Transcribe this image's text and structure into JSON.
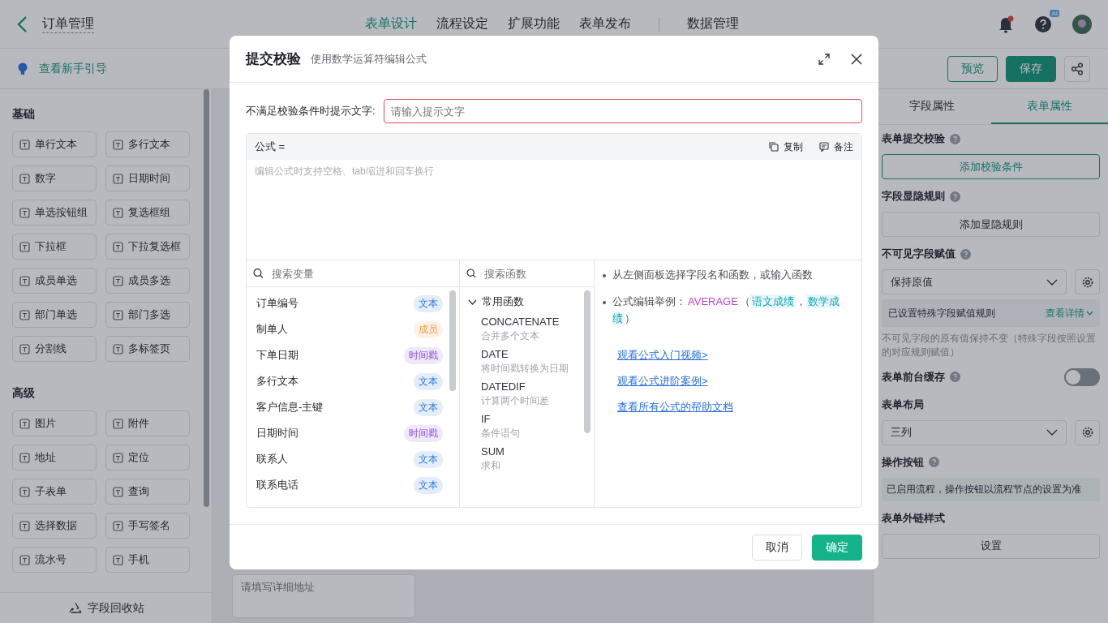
{
  "header": {
    "title": "订单管理",
    "nav": [
      {
        "label": "表单设计",
        "selected": true
      },
      {
        "label": "流程设定",
        "selected": false
      },
      {
        "label": "扩展功能",
        "selected": false
      },
      {
        "label": "表单发布",
        "selected": false
      }
    ],
    "data_nav": {
      "label": "数据管理",
      "selected": false
    },
    "notification": {
      "unread": true
    },
    "help_badge": "AI"
  },
  "toolbar": {
    "guide_link": "查看新手引导",
    "buttons": [
      {
        "label": "预览",
        "kind": "outline"
      },
      {
        "label": "保存",
        "kind": "primary"
      }
    ]
  },
  "sidebar": {
    "sections": [
      {
        "title": "基础",
        "items": [
          "单行文本",
          "多行文本",
          "数字",
          "日期时间",
          "单选按钮组",
          "复选框组",
          "下拉框",
          "下拉复选框",
          "成员单选",
          "成员多选",
          "部门单选",
          "部门多选",
          "分割线",
          "多标签页"
        ]
      },
      {
        "title": "高级",
        "items": [
          "图片",
          "附件",
          "地址",
          "定位",
          "子表单",
          "查询",
          "选择数据",
          "手写签名",
          "流水号",
          "手机"
        ]
      }
    ],
    "footer": "字段回收站"
  },
  "canvas": {
    "address_placeholder": "请填写详细地址"
  },
  "properties": {
    "tabs": [
      {
        "label": "字段属性",
        "selected": false
      },
      {
        "label": "表单属性",
        "selected": true
      }
    ],
    "sections": [
      {
        "title": "表单提交校验",
        "help": true,
        "controls": [
          {
            "kind": "button",
            "label": "添加校验条件",
            "accent": true
          }
        ]
      },
      {
        "title": "字段显隐规则",
        "help": true,
        "controls": [
          {
            "kind": "button",
            "label": "添加显隐规则",
            "accent": false
          }
        ]
      },
      {
        "title": "不可见字段赋值",
        "help": true,
        "controls": [
          {
            "kind": "select",
            "value": "保持原值"
          },
          {
            "kind": "notice",
            "text": "已设置特殊字段赋值规则",
            "link": "查看详情"
          },
          {
            "kind": "note",
            "text": "不可见字段的原有值保持不变（特殊字段按照设置的对应规则赋值）"
          }
        ]
      },
      {
        "title": "表单前台缓存",
        "help": true,
        "switch": {
          "on": false
        }
      },
      {
        "title": "表单布局",
        "help": false,
        "controls": [
          {
            "kind": "select",
            "value": "三列"
          }
        ]
      },
      {
        "title": "操作按钮",
        "help": true,
        "controls": [
          {
            "kind": "info",
            "text": "已启用流程，操作按钮以流程节点的设置为准"
          }
        ]
      },
      {
        "title": "表单外链样式",
        "help": false,
        "controls": [
          {
            "kind": "button",
            "label": "设置",
            "accent": false
          }
        ]
      }
    ]
  },
  "modal": {
    "title": "提交校验",
    "subtitle": "使用数学运算符编辑公式",
    "message": {
      "label": "不满足校验条件时提示文字:",
      "placeholder": "请输入提示文字",
      "invalid": true
    },
    "formula": {
      "label": "公式 =",
      "actions": [
        {
          "label": "复制",
          "kind": "copy"
        },
        {
          "label": "备注",
          "kind": "note"
        }
      ],
      "placeholder": "编辑公式时支持空格、tab缩进和回车换行"
    },
    "variables": {
      "search_placeholder": "搜索变量",
      "items": [
        {
          "name": "订单编号",
          "type": "文本",
          "color": "#2f7be0"
        },
        {
          "name": "制单人",
          "type": "成员",
          "color": "#f59a4a"
        },
        {
          "name": "下单日期",
          "type": "时间戳",
          "color": "#8a4fd8"
        },
        {
          "name": "多行文本",
          "type": "文本",
          "color": "#2f7be0"
        },
        {
          "name": "客户信息-主键",
          "type": "文本",
          "color": "#2f7be0"
        },
        {
          "name": "日期时间",
          "type": "时间戳",
          "color": "#8a4fd8"
        },
        {
          "name": "联系人",
          "type": "文本",
          "color": "#2f7be0"
        },
        {
          "name": "联系电话",
          "type": "文本",
          "color": "#2f7be0"
        }
      ]
    },
    "functions": {
      "search_placeholder": "搜索函数",
      "groups": [
        {
          "name": "常用函数",
          "expanded": true,
          "children": [
            {
              "name": "CONCATENATE",
              "description": "合并多个文本"
            },
            {
              "name": "DATE",
              "description": "将时间戳转换为日期"
            },
            {
              "name": "DATEDIF",
              "description": "计算两个时间差"
            },
            {
              "name": "IF",
              "description": "条件语句"
            },
            {
              "name": "SUM",
              "description": "求和"
            }
          ]
        }
      ]
    },
    "help": {
      "bullets": [
        [
          {
            "text": "从左侧面板选择字段名和函数，或输入函数",
            "kind": "plain"
          }
        ],
        [
          {
            "text": "公式编辑举例：",
            "kind": "plain"
          },
          {
            "text": "AVERAGE",
            "kind": "function"
          },
          {
            "text": "（",
            "kind": "plain"
          },
          {
            "text": "语文成绩",
            "kind": "field"
          },
          {
            "text": "，",
            "kind": "plain"
          },
          {
            "text": "数学成绩",
            "kind": "field"
          },
          {
            "text": "）",
            "kind": "plain"
          }
        ]
      ],
      "links": [
        "观看公式入门视频>",
        "观看公式进阶案例>",
        "查看所有公式的帮助文档"
      ]
    },
    "buttons": [
      {
        "label": "取消",
        "kind": "default"
      },
      {
        "label": "确定",
        "kind": "primary"
      }
    ]
  }
}
